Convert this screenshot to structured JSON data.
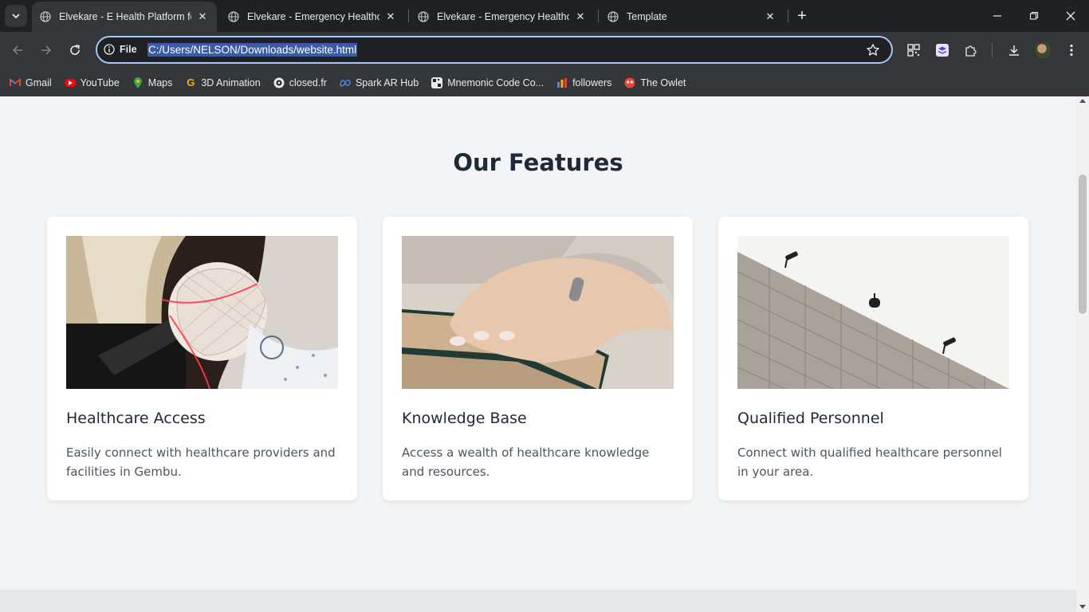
{
  "browser": {
    "tabs": [
      {
        "title": "Elvekare - E Health Platform for",
        "active": true
      },
      {
        "title": "Elvekare - Emergency Healthcar",
        "active": false
      },
      {
        "title": "Elvekare - Emergency Healthcar",
        "active": false
      },
      {
        "title": "Template",
        "active": false
      }
    ],
    "omnibox": {
      "scheme_label": "File",
      "url": "C:/Users/NELSON/Downloads/website.html"
    },
    "bookmarks": [
      {
        "label": "Gmail",
        "icon": "gmail-icon"
      },
      {
        "label": "YouTube",
        "icon": "youtube-icon"
      },
      {
        "label": "Maps",
        "icon": "maps-icon"
      },
      {
        "label": "3D Animation",
        "icon": "g-icon"
      },
      {
        "label": "closed.fr",
        "icon": "closed-icon"
      },
      {
        "label": "Spark AR Hub",
        "icon": "meta-icon"
      },
      {
        "label": "Mnemonic Code Co...",
        "icon": "mnemonic-icon"
      },
      {
        "label": "followers",
        "icon": "followers-icon"
      },
      {
        "label": "The Owlet",
        "icon": "owlet-icon"
      }
    ]
  },
  "page": {
    "section_title": "Our Features",
    "features": [
      {
        "title": "Healthcare Access",
        "description": "Easily connect with healthcare providers and facilities in Gembu.",
        "image": "patient-mri-scan-photo"
      },
      {
        "title": "Knowledge Base",
        "description": "Access a wealth of healthcare knowledge and resources.",
        "image": "hand-on-books-photo"
      },
      {
        "title": "Qualified Personnel",
        "description": "Connect with qualified healthcare personnel in your area.",
        "image": "security-cameras-wall-photo"
      }
    ]
  },
  "colors": {
    "page_background": "#f3f4f6",
    "card_background": "#ffffff",
    "heading": "#1f2937",
    "body_text": "#4b5563",
    "chrome_dark": "#202124",
    "chrome_toolbar": "#35363a",
    "omnibox_focus": "#a8c7fa"
  }
}
